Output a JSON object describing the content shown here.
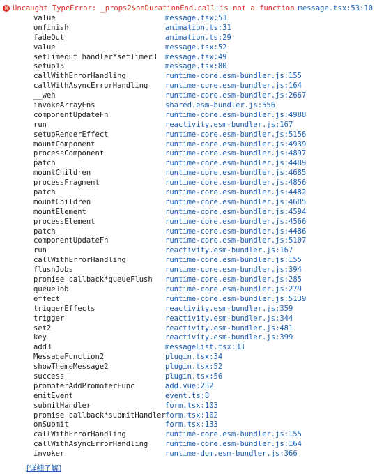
{
  "error": {
    "icon": "error-circle-icon",
    "icon_glyph": "×",
    "message": "Uncaught TypeError: _props2$onDurationEnd.call is not a function",
    "source": "message.tsx:53:10",
    "color": "#d93025"
  },
  "link_color": "#1a5fb4",
  "frames": [
    {
      "fn": "value",
      "loc": "message.tsx:53"
    },
    {
      "fn": "onfinish",
      "loc": "animation.ts:31"
    },
    {
      "fn": "fadeOut",
      "loc": "animation.ts:29"
    },
    {
      "fn": "value",
      "loc": "message.tsx:52"
    },
    {
      "fn": "setTimeout handler*setTimer3",
      "loc": "message.tsx:49"
    },
    {
      "fn": "setup15",
      "loc": "message.tsx:80"
    },
    {
      "fn": "callWithErrorHandling",
      "loc": "runtime-core.esm-bundler.js:155"
    },
    {
      "fn": "callWithAsyncErrorHandling",
      "loc": "runtime-core.esm-bundler.js:164"
    },
    {
      "fn": "__weh",
      "loc": "runtime-core.esm-bundler.js:2667"
    },
    {
      "fn": "invokeArrayFns",
      "loc": "shared.esm-bundler.js:556"
    },
    {
      "fn": "componentUpdateFn",
      "loc": "runtime-core.esm-bundler.js:4988"
    },
    {
      "fn": "run",
      "loc": "reactivity.esm-bundler.js:167"
    },
    {
      "fn": "setupRenderEffect",
      "loc": "runtime-core.esm-bundler.js:5156"
    },
    {
      "fn": "mountComponent",
      "loc": "runtime-core.esm-bundler.js:4939"
    },
    {
      "fn": "processComponent",
      "loc": "runtime-core.esm-bundler.js:4897"
    },
    {
      "fn": "patch",
      "loc": "runtime-core.esm-bundler.js:4489"
    },
    {
      "fn": "mountChildren",
      "loc": "runtime-core.esm-bundler.js:4685"
    },
    {
      "fn": "processFragment",
      "loc": "runtime-core.esm-bundler.js:4856"
    },
    {
      "fn": "patch",
      "loc": "runtime-core.esm-bundler.js:4482"
    },
    {
      "fn": "mountChildren",
      "loc": "runtime-core.esm-bundler.js:4685"
    },
    {
      "fn": "mountElement",
      "loc": "runtime-core.esm-bundler.js:4594"
    },
    {
      "fn": "processElement",
      "loc": "runtime-core.esm-bundler.js:4566"
    },
    {
      "fn": "patch",
      "loc": "runtime-core.esm-bundler.js:4486"
    },
    {
      "fn": "componentUpdateFn",
      "loc": "runtime-core.esm-bundler.js:5107"
    },
    {
      "fn": "run",
      "loc": "reactivity.esm-bundler.js:167"
    },
    {
      "fn": "callWithErrorHandling",
      "loc": "runtime-core.esm-bundler.js:155"
    },
    {
      "fn": "flushJobs",
      "loc": "runtime-core.esm-bundler.js:394"
    },
    {
      "fn": "promise callback*queueFlush",
      "loc": "runtime-core.esm-bundler.js:285"
    },
    {
      "fn": "queueJob",
      "loc": "runtime-core.esm-bundler.js:279"
    },
    {
      "fn": "effect",
      "loc": "runtime-core.esm-bundler.js:5139"
    },
    {
      "fn": "triggerEffects",
      "loc": "reactivity.esm-bundler.js:359"
    },
    {
      "fn": "trigger",
      "loc": "reactivity.esm-bundler.js:344"
    },
    {
      "fn": "set2",
      "loc": "reactivity.esm-bundler.js:481"
    },
    {
      "fn": "key",
      "loc": "reactivity.esm-bundler.js:399"
    },
    {
      "fn": "add3",
      "loc": "messageList.tsx:33"
    },
    {
      "fn": "MessageFunction2",
      "loc": "plugin.tsx:34"
    },
    {
      "fn": "showThemeMessage2",
      "loc": "plugin.tsx:52"
    },
    {
      "fn": "success",
      "loc": "plugin.tsx:56"
    },
    {
      "fn": "promoterAddPromoterFunc",
      "loc": "add.vue:232"
    },
    {
      "fn": "emitEvent",
      "loc": "event.ts:8"
    },
    {
      "fn": "submitHandler",
      "loc": "form.tsx:103"
    },
    {
      "fn": "promise callback*submitHandler",
      "loc": "form.tsx:102"
    },
    {
      "fn": "onSubmit",
      "loc": "form.tsx:133"
    },
    {
      "fn": "callWithErrorHandling",
      "loc": "runtime-core.esm-bundler.js:155"
    },
    {
      "fn": "callWithAsyncErrorHandling",
      "loc": "runtime-core.esm-bundler.js:164"
    },
    {
      "fn": "invoker",
      "loc": "runtime-dom.esm-bundler.js:366"
    }
  ],
  "learn_more": "[详细了解]"
}
